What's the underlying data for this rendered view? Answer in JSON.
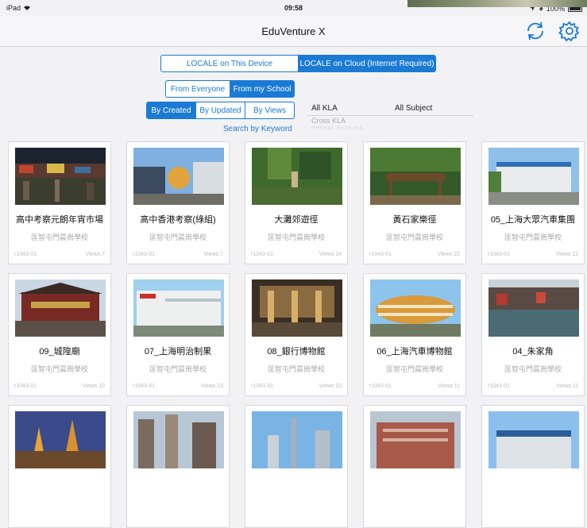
{
  "status_bar": {
    "device": "iPad",
    "time": "09:58",
    "battery": "100%"
  },
  "nav": {
    "title": "EduVenture X",
    "refresh_icon": "refresh-icon",
    "settings_icon": "gear-icon"
  },
  "source_tabs": [
    {
      "label": "LOCALE on This Device",
      "active": false
    },
    {
      "label": "LOCALE on Cloud (Internet Required)",
      "active": true
    }
  ],
  "scope_tabs": [
    {
      "label": "From Everyone",
      "active": false
    },
    {
      "label": "From my School",
      "active": true
    }
  ],
  "sort_tabs": [
    {
      "label": "By Created",
      "active": true
    },
    {
      "label": "By Updated",
      "active": false
    },
    {
      "label": "By Views",
      "active": false
    }
  ],
  "search_link": "Search by Keyword",
  "filters": {
    "kla": "All KLA",
    "subject": "All Subject",
    "kla_option": "Cross KLA",
    "kla_option_faint": "Personal, Social and..."
  },
  "colors": {
    "accent": "#1a7ad4",
    "background": "#f2f2f4"
  },
  "cards": [
    {
      "title": "高中考察元朗年宵市場",
      "school": "匡智屯門晨崗學校",
      "code": "r1043-01",
      "views": "Views:7"
    },
    {
      "title": "高中香港考察(綠組)",
      "school": "匡智屯門晨崗學校",
      "code": "r1043-01",
      "views": "Views:7"
    },
    {
      "title": "大灘郊遊徑",
      "school": "匡智屯門晨崗學校",
      "code": "r1043-01",
      "views": "Views:14"
    },
    {
      "title": "黃石家樂徑",
      "school": "匡智屯門晨崗學校",
      "code": "r1043-01",
      "views": "Views:22"
    },
    {
      "title": "05_上海大眾汽車集團",
      "school": "匡智屯門晨崗學校",
      "code": "r1043-01",
      "views": "Views:12"
    },
    {
      "title": "09_城隍廟",
      "school": "匡智屯門晨崗學校",
      "code": "r1043-01",
      "views": "Views:10"
    },
    {
      "title": "07_上海明治制果",
      "school": "匡智屯門晨崗學校",
      "code": "r1043-01",
      "views": "Views:13"
    },
    {
      "title": "08_銀行博物館",
      "school": "匡智屯門晨崗學校",
      "code": "r1043-01",
      "views": "Views:10"
    },
    {
      "title": "06_上海汽車博物館",
      "school": "匡智屯門晨崗學校",
      "code": "r1043-01",
      "views": "Views:11"
    },
    {
      "title": "04_朱家角",
      "school": "匡智屯門晨崗學校",
      "code": "r1043-01",
      "views": "Views:11"
    },
    {
      "title": "",
      "school": "",
      "code": "",
      "views": ""
    },
    {
      "title": "",
      "school": "",
      "code": "",
      "views": ""
    },
    {
      "title": "",
      "school": "",
      "code": "",
      "views": ""
    },
    {
      "title": "",
      "school": "",
      "code": "",
      "views": ""
    },
    {
      "title": "",
      "school": "",
      "code": "",
      "views": ""
    }
  ]
}
